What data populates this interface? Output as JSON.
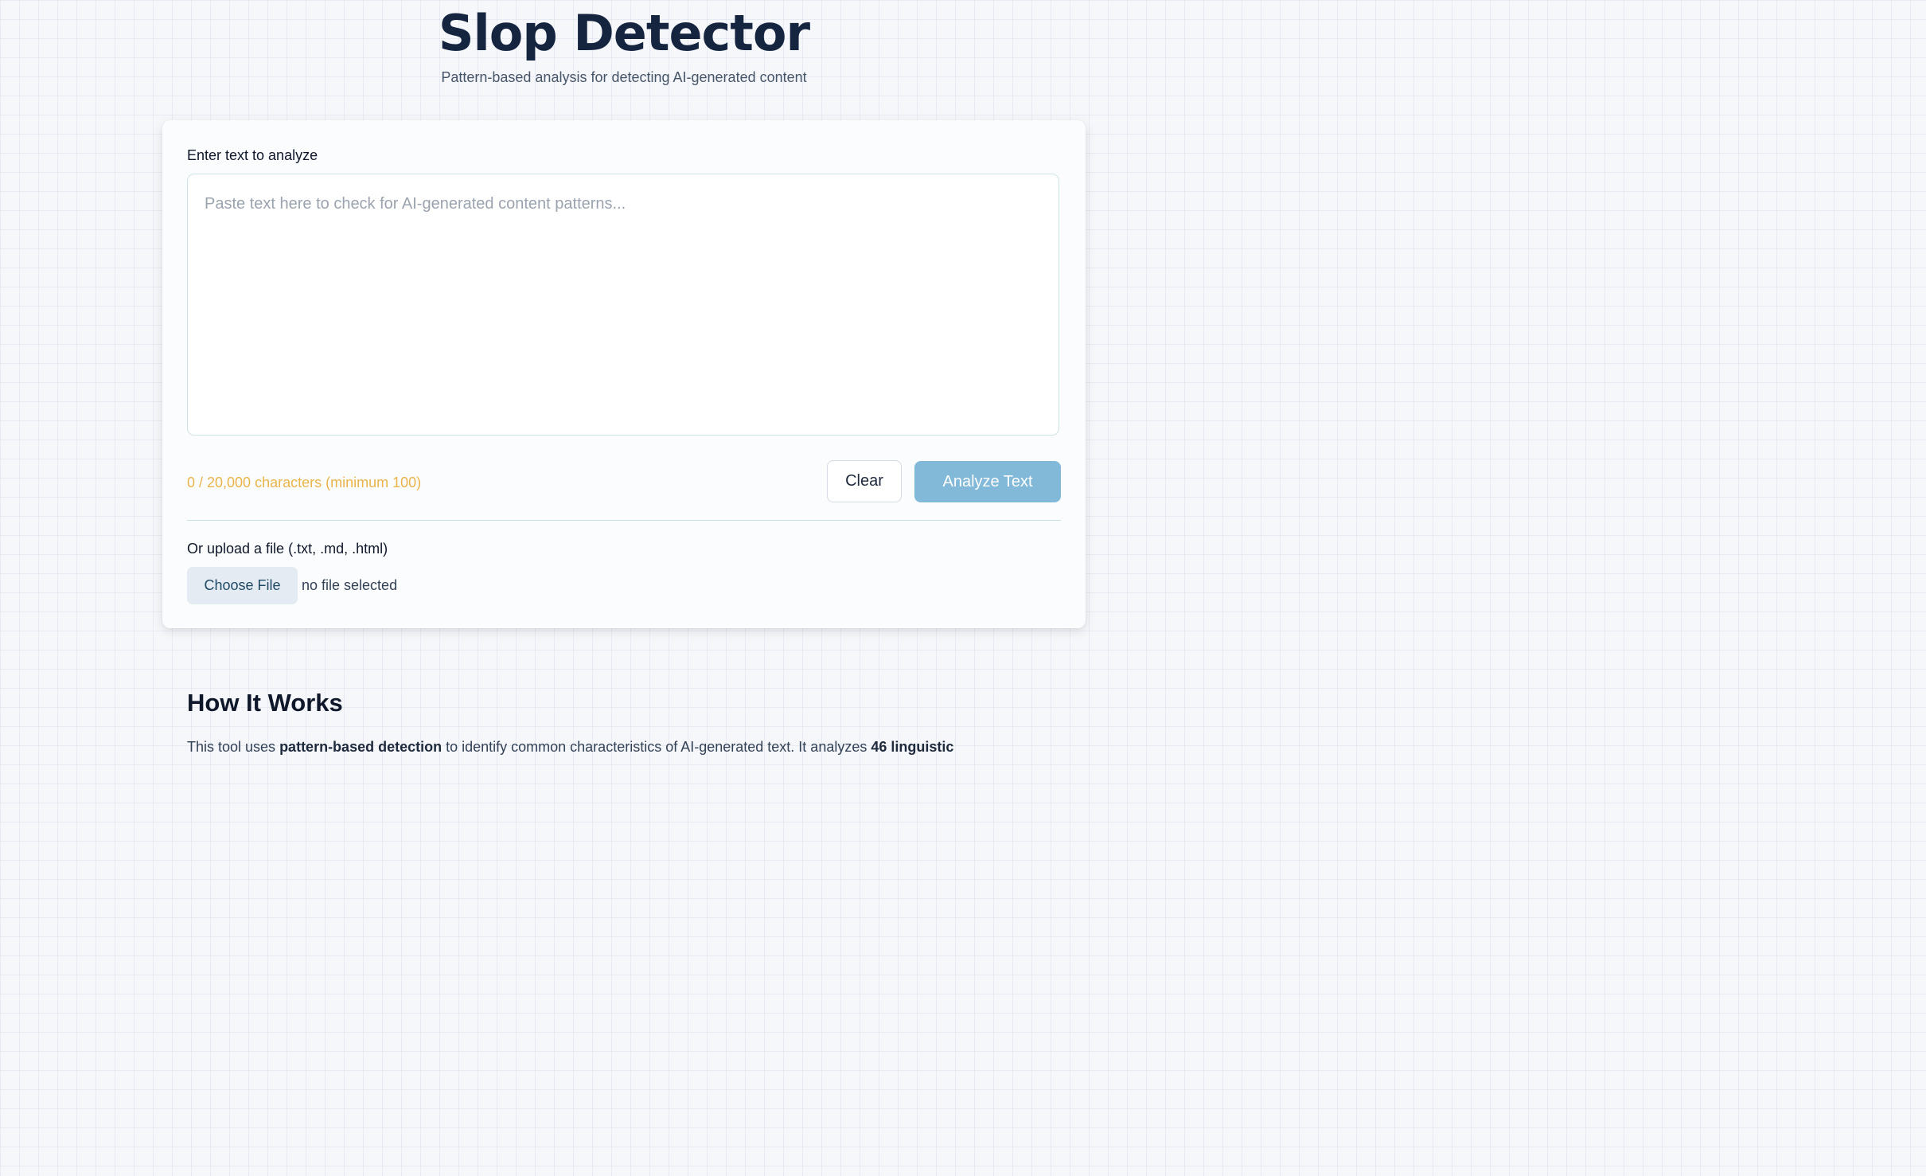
{
  "header": {
    "title": "Slop Detector",
    "subtitle": "Pattern-based analysis for detecting AI-generated content"
  },
  "analyzer": {
    "input_label": "Enter text to analyze",
    "textarea_placeholder": "Paste text here to check for AI-generated content patterns...",
    "textarea_value": "",
    "char_count": "0 / 20,000 characters (minimum 100)",
    "clear_label": "Clear",
    "analyze_label": "Analyze Text",
    "upload_label": "Or upload a file (.txt, .md, .html)",
    "choose_file_label": "Choose File",
    "file_status": "no file selected"
  },
  "how_it_works": {
    "title": "How It Works",
    "text_1": "This tool uses ",
    "text_bold_1": "pattern-based detection",
    "text_2": " to identify common characteristics of AI-generated text. It analyzes ",
    "text_bold_2": "46 linguistic"
  },
  "colors": {
    "title": "#152540",
    "char_count_warning": "#eab44a",
    "analyze_button_disabled": "#82b8d8",
    "background": "#f5f7fa"
  }
}
